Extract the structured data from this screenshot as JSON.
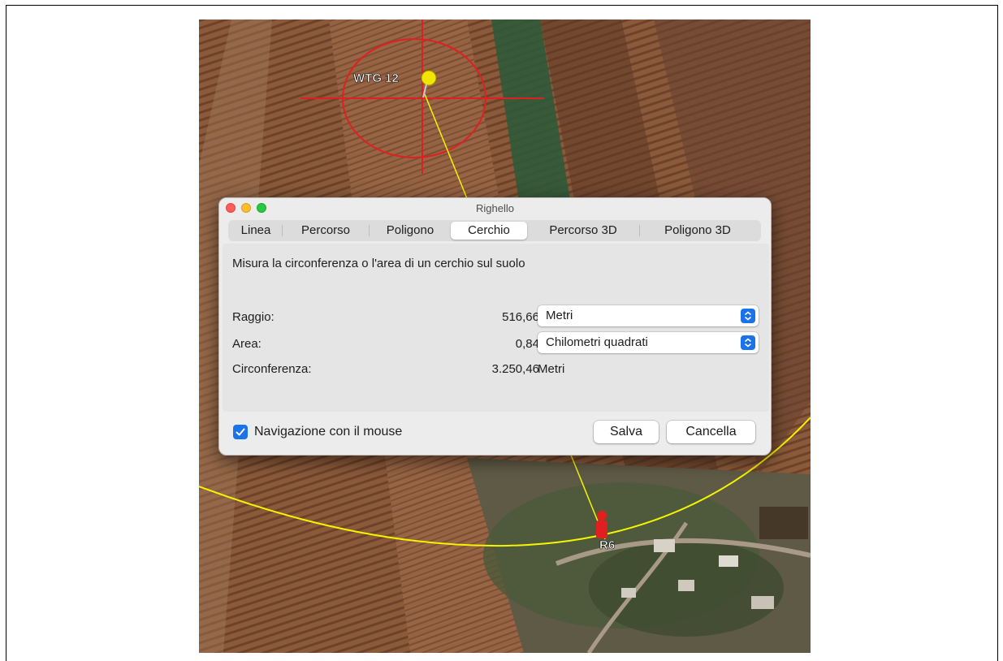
{
  "map": {
    "pin_label": "WTG 12",
    "receptor_label": "R6"
  },
  "window": {
    "title": "Righello"
  },
  "tabs": [
    {
      "label": "Linea",
      "selected": false
    },
    {
      "label": "Percorso",
      "selected": false
    },
    {
      "label": "Poligono",
      "selected": false
    },
    {
      "label": "Cerchio",
      "selected": true
    },
    {
      "label": "Percorso 3D",
      "selected": false
    },
    {
      "label": "Poligono 3D",
      "selected": false
    }
  ],
  "panel": {
    "description": "Misura la circonferenza o l'area di un cerchio sul suolo",
    "radius": {
      "label": "Raggio:",
      "value": "516,66",
      "unit": "Metri"
    },
    "area": {
      "label": "Area:",
      "value": "0,84",
      "unit": "Chilometri quadrati"
    },
    "circumference": {
      "label": "Circonferenza:",
      "value": "3.250,46",
      "unit": "Metri"
    }
  },
  "footer": {
    "mouse_nav_label": "Navigazione con il mouse",
    "mouse_nav_checked": true,
    "save_label": "Salva",
    "cancel_label": "Cancella"
  },
  "colors": {
    "accent": "#1a73e8",
    "measure_circle": "#e02020",
    "buffer_circle": "#f5f500"
  },
  "icons": {
    "pin": "pushpin-icon",
    "receptor": "person-icon"
  }
}
